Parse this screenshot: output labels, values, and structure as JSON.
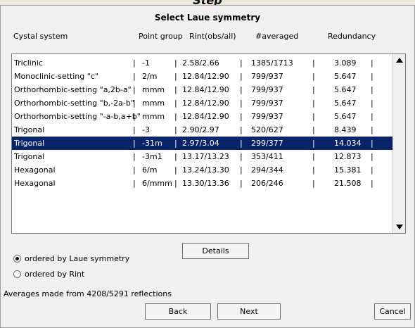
{
  "window_title": "Step",
  "dialog": {
    "title": "Select Laue symmetry",
    "columns": [
      "Cystal system",
      "Point group",
      "Rint(obs/all)",
      "#averaged",
      "Redundancy"
    ],
    "rows": [
      {
        "system": "Triclinic",
        "group": "-1",
        "rint": "2.58/2.66",
        "averaged": "1385/1713",
        "redundancy": "3.089"
      },
      {
        "system": "Monoclinic-setting \"c\"",
        "group": "2/m",
        "rint": "12.84/12.90",
        "averaged": "799/937",
        "redundancy": "5.647"
      },
      {
        "system": "Orthorhombic-setting \"a,2b-a\"",
        "group": "mmm",
        "rint": "12.84/12.90",
        "averaged": "799/937",
        "redundancy": "5.647"
      },
      {
        "system": "Orthorhombic-setting \"b,-2a-b\"",
        "group": "mmm",
        "rint": "12.84/12.90",
        "averaged": "799/937",
        "redundancy": "5.647"
      },
      {
        "system": "Orthorhombic-setting \"-a-b,a+b\"",
        "group": "mmm",
        "rint": "12.84/12.90",
        "averaged": "799/937",
        "redundancy": "5.647"
      },
      {
        "system": "Trigonal",
        "group": "-3",
        "rint": "2.90/2.97",
        "averaged": "520/627",
        "redundancy": "8.439"
      },
      {
        "system": "Trigonal",
        "group": "-31m",
        "rint": "2.97/3.04",
        "averaged": "299/377",
        "redundancy": "14.034"
      },
      {
        "system": "Trigonal",
        "group": "-3m1",
        "rint": "13.17/13.23",
        "averaged": "353/411",
        "redundancy": "12.873"
      },
      {
        "system": "Hexagonal",
        "group": "6/m",
        "rint": "13.24/13.30",
        "averaged": "294/344",
        "redundancy": "15.381"
      },
      {
        "system": "Hexagonal",
        "group": "6/mmm",
        "rint": "13.30/13.36",
        "averaged": "206/246",
        "redundancy": "21.508"
      }
    ],
    "selected_row": 6,
    "separator": "|",
    "radio_laue": "ordered by Laue symmetry",
    "radio_rint": "ordered by Rint",
    "radio_checked": "laue",
    "details_button": "Details",
    "status": "Averages made from 4208/5291 reflections",
    "back_button": "Back",
    "next_button": "Next",
    "cancel_button": "Cancel",
    "selected_color": "#0a246a"
  }
}
